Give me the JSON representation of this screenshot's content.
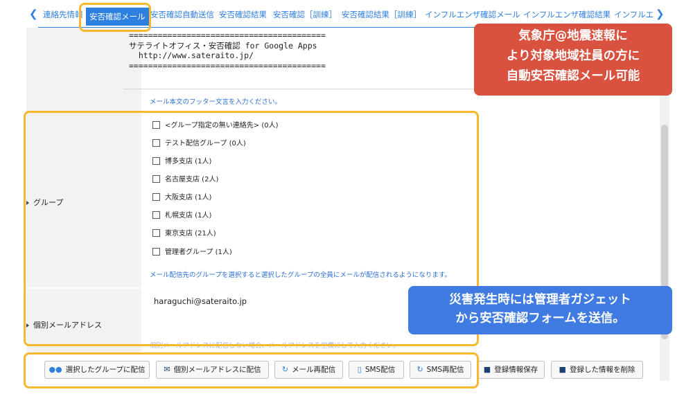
{
  "tabs": {
    "items": [
      {
        "label": "連絡先情報"
      },
      {
        "label": "安否確認メール",
        "active": true
      },
      {
        "label": "安否確認自動送信"
      },
      {
        "label": "安否確認結果"
      },
      {
        "label": "安否確認［訓練］"
      },
      {
        "label": "安否確認結果［訓練］"
      },
      {
        "label": "インフルエンザ確認メール"
      },
      {
        "label": "インフルエンザ確認結果"
      },
      {
        "label": "インフルエ"
      }
    ],
    "left_icon": "chevron-left-icon",
    "right_icon": "chevron-right-icon"
  },
  "footer_field": {
    "text": "=========================================\nサテライトオフィス・安否確認 for Google Apps\n  http://www.sateraito.jp/\n=========================================",
    "hint": "メール本文のフッター文言を入力ください。"
  },
  "group_section": {
    "label": "グループ",
    "options": [
      {
        "label": "<グループ指定の無い連絡先> (0人)"
      },
      {
        "label": "テスト配信グループ (0人)"
      },
      {
        "label": "博多支店 (1人)"
      },
      {
        "label": "名古屋支店 (2人)"
      },
      {
        "label": "大阪支店 (1人)"
      },
      {
        "label": "札幌支店 (1人)"
      },
      {
        "label": "東京支店 (21人)"
      },
      {
        "label": "管理者グループ (1人)"
      }
    ],
    "hint": "メール配信先のグループを選択すると選択したグループの全員にメールが配信されるようになります。"
  },
  "individual_section": {
    "label": "個別メールアドレス",
    "value": "haraguchi@sateraito.jp",
    "hint": "個別メールアドレスに配信しない場合、メールアドレスを空欄にして入力ください。"
  },
  "actions": {
    "send_group": "選択したグループに配信",
    "send_individual": "個別メールアドレスに配信",
    "resend_mail": "メール再配信",
    "send_sms": "SMS配信",
    "resend_sms": "SMS再配信",
    "save": "登録情報保存",
    "delete": "登録した情報を削除"
  },
  "callouts": {
    "red_line1": "気象庁@地震速報に",
    "red_line2": "より対象地域社員の方に",
    "red_line3": "自動安否確認メール可能",
    "blue_line1": "災害発生時には管理者ガジェット",
    "blue_line2": "から安否確認フォームを送信。"
  },
  "colors": {
    "accent": "#2d7fe0",
    "highlight": "#f5b82e",
    "callout_red": "#d9523f",
    "callout_blue": "#3f7be0"
  }
}
